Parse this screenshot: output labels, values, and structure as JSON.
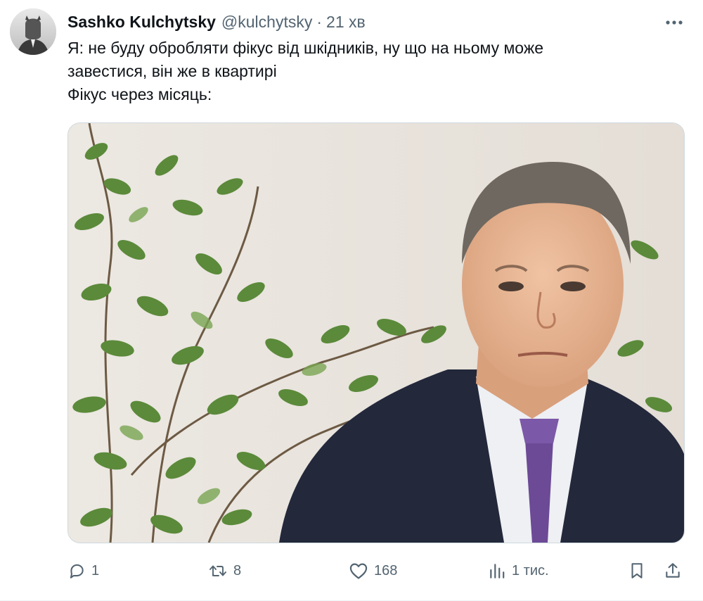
{
  "author": {
    "display_name": "Sashko Kulchytsky",
    "handle": "@kulchytsky",
    "separator": "·",
    "time": "21 хв"
  },
  "tweet": {
    "lines": [
      "Я: не буду обробляти фікус від шкідників, ну що на ньому може",
      "завестися, він же в квартирі",
      "Фікус через місяць:"
    ]
  },
  "actions": {
    "replies": "1",
    "retweets": "8",
    "likes": "168",
    "views": "1 тис."
  },
  "icons": {
    "more": "more-horizontal-icon",
    "reply": "reply-icon",
    "retweet": "retweet-icon",
    "like": "heart-icon",
    "views": "views-chart-icon",
    "bookmark": "bookmark-icon",
    "share": "share-icon"
  },
  "colors": {
    "text_primary": "#0f1419",
    "text_secondary": "#536471",
    "border": "#cfd9de"
  }
}
